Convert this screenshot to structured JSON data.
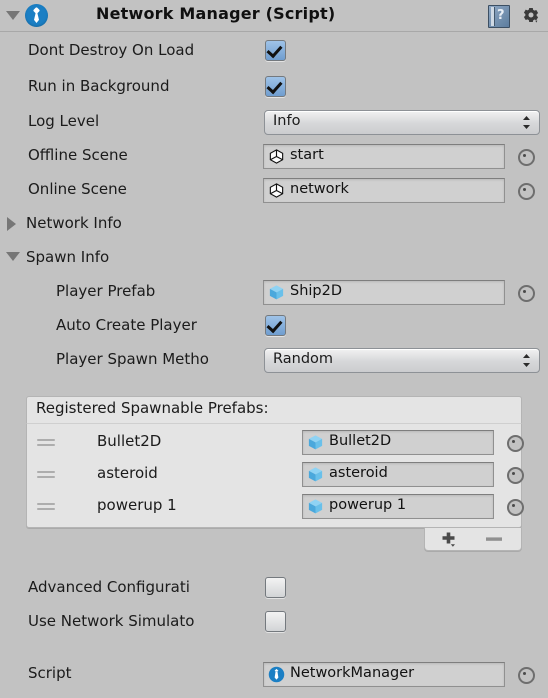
{
  "header": {
    "foldout": "expanded",
    "title": "Network Manager (Script)",
    "script_icon": "unity-script-icon",
    "help_icon": "help-book-icon",
    "gear_icon": "gear-icon"
  },
  "theme": {
    "background": "#c2c2c2",
    "list_background": "#e4e4e4",
    "field_background": "#d0d0d0",
    "checkbox_checked": "#7ba5d4",
    "script_badge": "#1b7fc4",
    "prefab_cube": "#5db4e8"
  },
  "fields": {
    "dont_destroy_on_load": {
      "label": "Dont Destroy On Load",
      "checked": true
    },
    "run_in_background": {
      "label": "Run in Background",
      "checked": true
    },
    "log_level": {
      "label": "Log Level",
      "value": "Info"
    },
    "offline_scene": {
      "label": "Offline Scene",
      "value": "start",
      "icon": "unity-scene-icon"
    },
    "online_scene": {
      "label": "Online Scene",
      "value": "network",
      "icon": "unity-scene-icon"
    }
  },
  "network_info": {
    "label": "Network Info",
    "foldout": "collapsed"
  },
  "spawn_info": {
    "label": "Spawn Info",
    "foldout": "expanded",
    "player_prefab": {
      "label": "Player Prefab",
      "value": "Ship2D",
      "icon": "prefab-cube-icon"
    },
    "auto_create_player": {
      "label": "Auto Create Player",
      "checked": true
    },
    "player_spawn_method": {
      "label": "Player Spawn Metho",
      "value": "Random"
    }
  },
  "spawnable_prefabs": {
    "header": "Registered Spawnable Prefabs:",
    "rows": [
      {
        "name": "Bullet2D",
        "value": "Bullet2D",
        "icon": "prefab-cube-icon"
      },
      {
        "name": "asteroid",
        "value": "asteroid",
        "icon": "prefab-cube-icon"
      },
      {
        "name": "powerup 1",
        "value": "powerup 1",
        "icon": "prefab-cube-icon"
      }
    ],
    "add_button": "+",
    "remove_button": "−"
  },
  "advanced": {
    "advanced_configuration": {
      "label": "Advanced Configurati",
      "checked": false
    },
    "use_network_simulator": {
      "label": "Use Network Simulato",
      "checked": false
    }
  },
  "script_field": {
    "label": "Script",
    "value": "NetworkManager",
    "icon": "unity-script-icon"
  }
}
